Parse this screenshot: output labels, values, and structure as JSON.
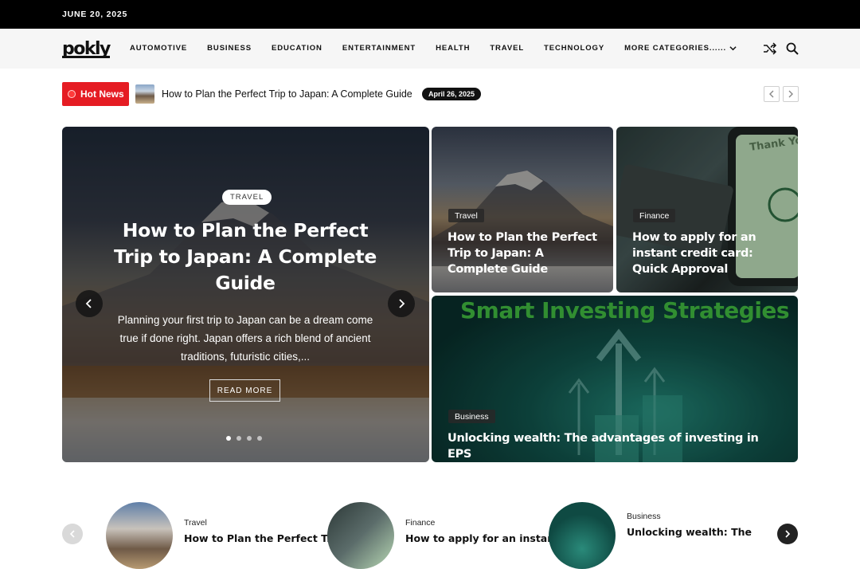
{
  "topbar": {
    "date": "JUNE 20, 2025"
  },
  "header": {
    "logo_text": "pokly",
    "nav": [
      "AUTOMOTIVE",
      "BUSINESS",
      "EDUCATION",
      "ENTERTAINMENT",
      "HEALTH",
      "TRAVEL",
      "TECHNOLOGY",
      "MORE CATEGORIES......"
    ]
  },
  "ticker": {
    "label": "Hot News",
    "headline": "How to Plan the Perfect Trip to Japan: A Complete Guide",
    "date": "April 26, 2025"
  },
  "hero": {
    "category": "TRAVEL",
    "title": "How to Plan the Perfect Trip to Japan: A Complete Guide",
    "description": "Planning your first trip to Japan can be a dream come true if done right. Japan offers a rich blend of ancient traditions, futuristic cities,...",
    "read_more": "READ MORE"
  },
  "cards": [
    {
      "category": "Travel",
      "title": "How to Plan the Perfect Trip to Japan: A Complete Guide"
    },
    {
      "category": "Finance",
      "title": "How to apply for an instant credit card: Quick Approval",
      "image_text": "Thank Yo"
    },
    {
      "category": "Business",
      "title": "Unlocking wealth: The advantages of investing in EPS",
      "image_text": "Smart Investing Strategies"
    }
  ],
  "carousel": [
    {
      "category": "Travel",
      "title": "How to Plan the Perfect Trip"
    },
    {
      "category": "Finance",
      "title": "How to apply for an instant"
    },
    {
      "category": "Business",
      "title": "Unlocking wealth: The"
    }
  ],
  "colors": {
    "hot_news": "#e51c23",
    "topbar": "#000000",
    "nav_bg": "#f6f6f6"
  }
}
